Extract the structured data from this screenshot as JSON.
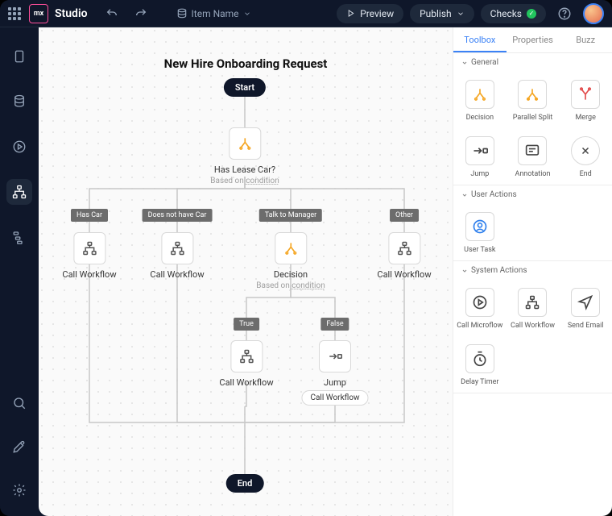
{
  "header": {
    "brand": "Studio",
    "logo": "mx",
    "item_label": "Item Name",
    "preview": "Preview",
    "publish": "Publish",
    "checks": "Checks"
  },
  "workflow": {
    "title": "New Hire Onboarding Request",
    "start": "Start",
    "end": "End",
    "lease": {
      "label": "Has Lease Car?",
      "hint_pre": "Based on ",
      "hint_link": "condition"
    },
    "decision": {
      "label": "Decision",
      "hint_pre": "Based on ",
      "hint_link": "condition"
    },
    "edges": {
      "has_car": "Has Car",
      "no_car": "Does not have Car",
      "talk": "Talk to Manager",
      "other": "Other",
      "true": "True",
      "false": "False"
    },
    "nodes": {
      "cw": "Call Workflow",
      "jump": "Jump"
    },
    "jump_chip": "Call Workflow"
  },
  "panel": {
    "tabs": {
      "toolbox": "Toolbox",
      "properties": "Properties",
      "buzz": "Buzz"
    },
    "sections": {
      "general": {
        "title": "General",
        "items": [
          {
            "id": "decision",
            "label": "Decision"
          },
          {
            "id": "parallel",
            "label": "Parallel Split"
          },
          {
            "id": "merge",
            "label": "Merge"
          },
          {
            "id": "jump",
            "label": "Jump"
          },
          {
            "id": "annotation",
            "label": "Annotation"
          },
          {
            "id": "end",
            "label": "End"
          }
        ]
      },
      "user": {
        "title": "User Actions",
        "items": [
          {
            "id": "usertask",
            "label": "User Task"
          }
        ]
      },
      "system": {
        "title": "System Actions",
        "items": [
          {
            "id": "microflow",
            "label": "Call Microflow"
          },
          {
            "id": "callwf",
            "label": "Call Workflow"
          },
          {
            "id": "sendemail",
            "label": "Send Email"
          },
          {
            "id": "delay",
            "label": "Delay Timer"
          }
        ]
      }
    }
  }
}
